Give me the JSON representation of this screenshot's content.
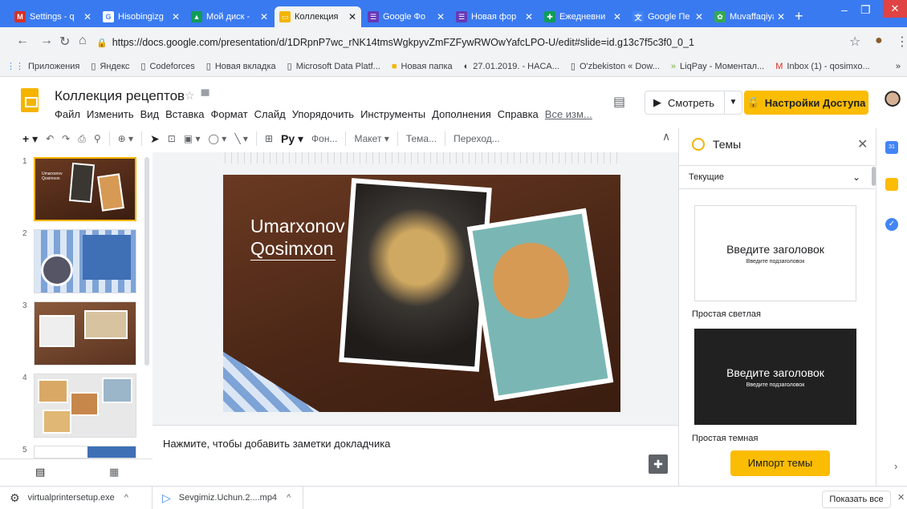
{
  "browser": {
    "tabs": [
      {
        "label": "Settings - q",
        "icon": "gmail-icon",
        "color": "#ffffff",
        "active": false
      },
      {
        "label": "Hisobingizg",
        "icon": "google-icon",
        "color": "#ffffff",
        "active": false
      },
      {
        "label": "Мой диск -",
        "icon": "drive-icon",
        "color": "#ffffff",
        "active": false
      },
      {
        "label": "Коллекция",
        "icon": "slides-icon",
        "color": "#f4b400",
        "active": true
      },
      {
        "label": "Google Фо",
        "icon": "forms-icon",
        "color": "#673ab7",
        "active": false
      },
      {
        "label": "Новая фор",
        "icon": "forms-icon",
        "color": "#673ab7",
        "active": false
      },
      {
        "label": "Ежедневни",
        "icon": "plus-icon",
        "color": "#0f9d58",
        "active": false
      },
      {
        "label": "Google Пе",
        "icon": "translate-icon",
        "color": "#4285f4",
        "active": false
      },
      {
        "label": "Muvaffaqiya",
        "icon": "site-icon",
        "color": "#34a853",
        "active": false
      }
    ],
    "url": "https://docs.google.com/presentation/d/1DRpnP7wc_rNK14tmsWgkpyvZmFZFywRWOwYafcLPO-U/edit#slide=id.g13c7f5c3f0_0_1",
    "bookmarks": [
      {
        "label": "Приложения",
        "icon": "apps-icon"
      },
      {
        "label": "Яндекс",
        "icon": "page-icon"
      },
      {
        "label": "Codeforces",
        "icon": "page-icon"
      },
      {
        "label": "Новая вкладка",
        "icon": "page-icon"
      },
      {
        "label": "Microsoft Data Platf...",
        "icon": "page-icon"
      },
      {
        "label": "Новая папка",
        "icon": "folder-icon"
      },
      {
        "label": "27.01.2019. - HACA...",
        "icon": "site-icon"
      },
      {
        "label": "O'zbekiston « Dow...",
        "icon": "page-icon"
      },
      {
        "label": "LiqPay - Моментал...",
        "icon": "liqpay-icon"
      },
      {
        "label": "Inbox (1) - qosimxo...",
        "icon": "gmail-icon"
      }
    ],
    "bookmarks_more": "»"
  },
  "doc": {
    "title": "Коллекция рецептов",
    "menu": [
      "Файл",
      "Изменить",
      "Вид",
      "Вставка",
      "Формат",
      "Слайд",
      "Упорядочить",
      "Инструменты",
      "Дополнения",
      "Справка"
    ],
    "last_edit": "Все изм...",
    "present_label": "Смотреть",
    "share_label": "Настройки Доступа"
  },
  "toolbar": {
    "lang_label": "Ру",
    "background_label": "Фон...",
    "layout_label": "Макет",
    "theme_label": "Тема...",
    "transition_label": "Переход..."
  },
  "slides": [
    {
      "number": "1",
      "caption": "Umarxonov Qosimxon"
    },
    {
      "number": "2"
    },
    {
      "number": "3"
    },
    {
      "number": "4"
    },
    {
      "number": "5"
    }
  ],
  "slide": {
    "title_line1": "Umarxonov",
    "title_line2": "Qosimxon"
  },
  "notes": {
    "placeholder": "Нажмите, чтобы добавить заметки докладчика"
  },
  "themes": {
    "title": "Темы",
    "section": "Текущие",
    "cards": [
      {
        "heading": "Введите заголовок",
        "subheading": "Введите подзаголовок",
        "name": "Простая светлая",
        "bg": "#ffffff",
        "fg": "#202124"
      },
      {
        "heading": "Введите заголовок",
        "subheading": "Введите подзаголовок",
        "name": "Простая темная",
        "bg": "#212121",
        "fg": "#ffffff"
      }
    ],
    "import_label": "Импорт темы"
  },
  "downloads": {
    "items": [
      {
        "name": "virtualprintersetup.exe"
      },
      {
        "name": "Sevgimiz.Uchun.2....mp4"
      }
    ],
    "show_all": "Показать все"
  },
  "colors": {
    "accent": "#fbbc04",
    "chrome_blue": "#3a7af0"
  }
}
